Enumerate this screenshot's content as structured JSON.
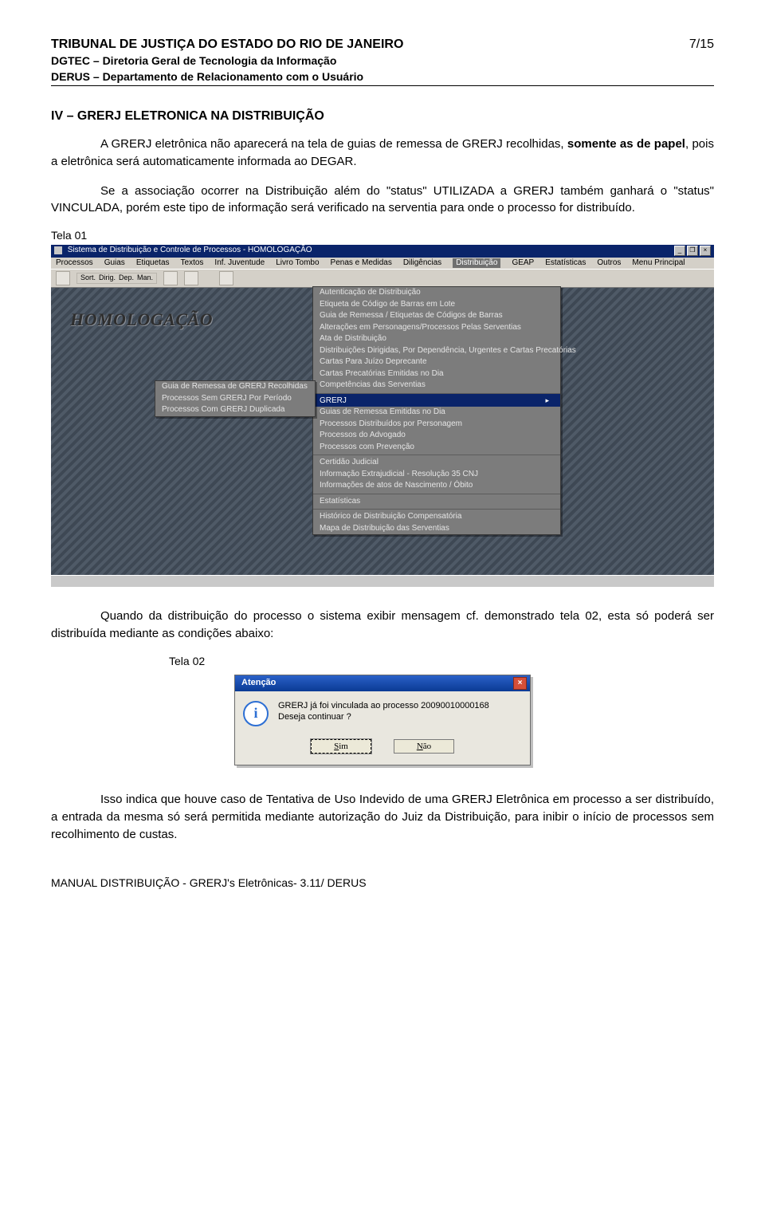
{
  "header": {
    "line1": "TRIBUNAL DE JUSTIÇA DO ESTADO DO RIO DE JANEIRO",
    "line2": "DGTEC – Diretoria Geral de Tecnologia da Informação",
    "line3": "DERUS – Departamento de Relacionamento com o Usuário",
    "page_num": "7/15"
  },
  "section_title": "IV – GRERJ ELETRONICA NA DISTRIBUIÇÃO",
  "para1_pre": "A GRERJ eletrônica não aparecerá na tela de guias de remessa de GRERJ recolhidas, ",
  "para1_bold": "somente as de papel",
  "para1_post": ", pois a eletrônica será automaticamente informada ao DEGAR.",
  "para2": "Se a associação ocorrer na Distribuição além do \"status\" UTILIZADA a GRERJ também ganhará o \"status\" VINCULADA, porém este tipo de informação será verificado na serventia para onde o processo for distribuído.",
  "tela01_label": "Tela 01",
  "shot1": {
    "window_title": "Sistema de Distribuição e Controle de Processos - HOMOLOGAÇÃO",
    "menu_bar": [
      "Processos",
      "Guias",
      "Etiquetas",
      "Textos",
      "Inf. Juventude",
      "Livro Tombo",
      "Penas e Medidas",
      "Diligências",
      "Distribuição",
      "GEAP",
      "Estatísticas",
      "Outros",
      "Menu Principal"
    ],
    "toolbar": [
      "Sort.",
      "Dirig.",
      "Dep.",
      "Man."
    ],
    "watermark": "HOMOLOGAÇÃO",
    "main_menu": {
      "items": [
        "Autenticação de Distribuição",
        "Etiqueta de Código de Barras em Lote",
        "Guia de Remessa / Etiquetas de Códigos de Barras",
        "Alterações em Personagens/Processos Pelas Serventias",
        "Ata de Distribuição",
        "Distribuições Dirigidas, Por Dependência, Urgentes e Cartas Precatórias",
        "Cartas Para Juízo Deprecante",
        "Cartas Precatórias Emitidas no Dia",
        "Competências das Serventias",
        "GRERJ",
        "Guias de Remessa Emitidas no Dia",
        "Processos Distribuídos por Personagem",
        "Processos do Advogado",
        "Processos com Prevenção",
        "Certidão Judicial",
        "Informação Extrajudicial - Resolução 35 CNJ",
        "Informações de atos de Nascimento / Óbito",
        "Estatísticas",
        "Histórico de Distribuição Compensatória",
        "Mapa de Distribuição das Serventias"
      ],
      "sep_before": [
        9,
        14,
        17,
        18
      ],
      "highlight_index": 9
    },
    "sub_menu": {
      "items": [
        "Guia de Remessa de GRERJ Recolhidas",
        "Processos Sem GRERJ Por Período",
        "Processos Com GRERJ Duplicada"
      ]
    }
  },
  "para3": "Quando da distribuição do processo o sistema exibir mensagem cf. demonstrado tela 02, esta só poderá ser distribuída mediante as condições abaixo:",
  "tela02_label": "Tela 02",
  "alert": {
    "title": "Atenção",
    "line1": "GRERJ já foi vinculada ao processo 20090010000168",
    "line2": "Deseja continuar ?",
    "btn_yes": "Sim",
    "btn_no": "Não"
  },
  "para4": "Isso indica que houve caso de Tentativa de Uso Indevido de uma GRERJ Eletrônica em processo a ser distribuído, a entrada da mesma só será permitida mediante autorização do Juiz da Distribuição, para inibir o início de processos sem recolhimento de custas.",
  "footer": "MANUAL DISTRIBUIÇÃO - GRERJ's Eletrônicas- 3.11/ DERUS"
}
